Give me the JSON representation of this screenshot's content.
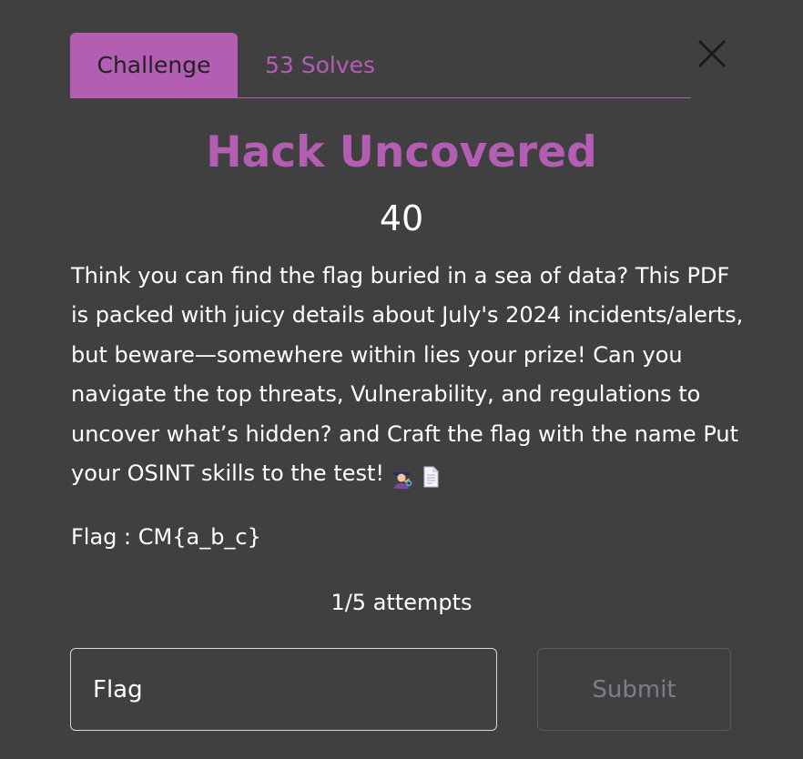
{
  "tabs": {
    "challenge_label": "Challenge",
    "solves_label": "53 Solves"
  },
  "challenge": {
    "title": "Hack Uncovered",
    "points": "40",
    "description": "Think you can find the flag buried in a sea of data? This PDF is packed with juicy details about July's 2024 incidents/alerts, but beware—somewhere within lies your prize! Can you navigate the top threats, Vulnerability, and regulations to uncover what’s hidden? and Craft the flag with the name Put your OSINT skills to the test!",
    "flag_format": "Flag : CM{a_b_c}",
    "attempts": "1/5 attempts"
  },
  "form": {
    "flag_placeholder": "Flag",
    "submit_label": "Submit"
  },
  "icons": {
    "close": "close-icon",
    "detective": "detective-emoji-icon",
    "document": "page-document-emoji-icon"
  },
  "colors": {
    "background": "#404040",
    "accent": "#b35db3",
    "text": "#ffffff",
    "submit_text": "#7a7f86"
  }
}
